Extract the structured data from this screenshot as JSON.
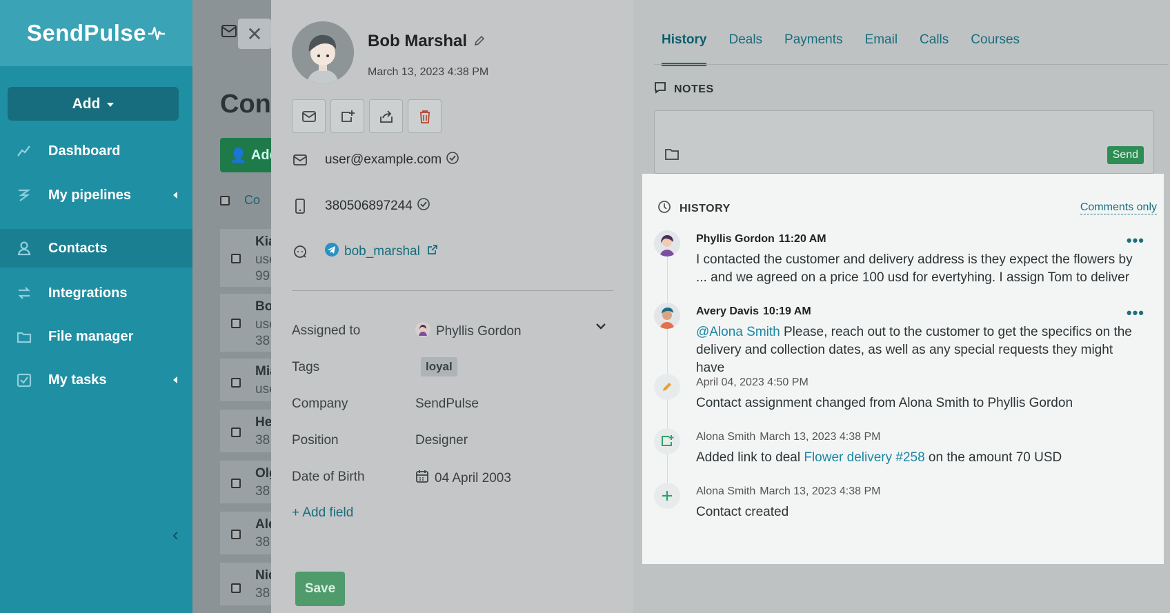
{
  "sidebar": {
    "logo": "SendPulse",
    "add_label": "Add",
    "items": [
      {
        "label": "Dashboard",
        "icon": "chart-line-icon"
      },
      {
        "label": "My pipelines",
        "icon": "pipeline-icon"
      },
      {
        "label": "Contacts",
        "icon": "contacts-icon"
      },
      {
        "label": "Integrations",
        "icon": "integrations-icon"
      },
      {
        "label": "File manager",
        "icon": "folder-icon"
      },
      {
        "label": "My tasks",
        "icon": "tasks-icon"
      }
    ]
  },
  "background": {
    "title": "Con",
    "add_label": "Add",
    "col_head": "Co",
    "rows": [
      {
        "name": "Kia",
        "line1": "use",
        "line2": "99"
      },
      {
        "name": "Bo",
        "line1": "use",
        "line2": "38"
      },
      {
        "name": "Mia",
        "line1": "use",
        "line2": ""
      },
      {
        "name": "He",
        "line1": "38",
        "line2": ""
      },
      {
        "name": "Olg",
        "line1": "38",
        "line2": ""
      },
      {
        "name": "Ale",
        "line1": "38",
        "line2": ""
      },
      {
        "name": "Nic",
        "line1": "38",
        "line2": ""
      }
    ]
  },
  "contact": {
    "name": "Bob Marshal",
    "created": "March 13, 2023 4:38 PM",
    "email": "user@example.com",
    "phone": "380506897244",
    "telegram": "bob_marshal",
    "fields": {
      "assigned_label": "Assigned to",
      "assigned_value": "Phyllis Gordon",
      "tags_label": "Tags",
      "tag": "loyal",
      "company_label": "Company",
      "company_value": "SendPulse",
      "position_label": "Position",
      "position_value": "Designer",
      "dob_label": "Date of Birth",
      "dob_value": "04 April 2003"
    },
    "add_field": "+ Add field",
    "save_label": "Save"
  },
  "tabs": [
    "History",
    "Deals",
    "Payments",
    "Email",
    "Calls",
    "Courses"
  ],
  "notes": {
    "heading": "NOTES",
    "send_label": "Send"
  },
  "history": {
    "heading": "HISTORY",
    "filter": "Comments only",
    "entries": [
      {
        "author": "Phyllis Gordon",
        "time": "11:20 AM",
        "text": "I contacted the customer and delivery address is they expect the flowers by ... and we agreed on a price 100 usd for evertyhing. I assign Tom to deliver"
      },
      {
        "author": "Avery Davis",
        "time": "10:19 AM",
        "mention": "@Alona Smith",
        "text": " Please, reach out to the customer to get the specifics on the delivery and collection dates, as well as any special requests they might have"
      },
      {
        "author": "",
        "time": "April 04, 2023 4:50 PM",
        "text": "Contact assignment changed from Alona Smith to Phyllis Gordon"
      },
      {
        "author": "Alona Smith",
        "time": "March 13, 2023 4:38 PM",
        "text_before": "Added link to deal ",
        "link": "Flower delivery #258",
        "text_after": " on the amount 70 USD"
      },
      {
        "author": "Alona Smith",
        "time": "March 13, 2023 4:38 PM",
        "text": "Contact created"
      }
    ]
  },
  "colors": {
    "sidebar": "#1f8fa3",
    "accent": "#176d7d",
    "send": "#2e8d55",
    "link": "#1b87a3"
  }
}
